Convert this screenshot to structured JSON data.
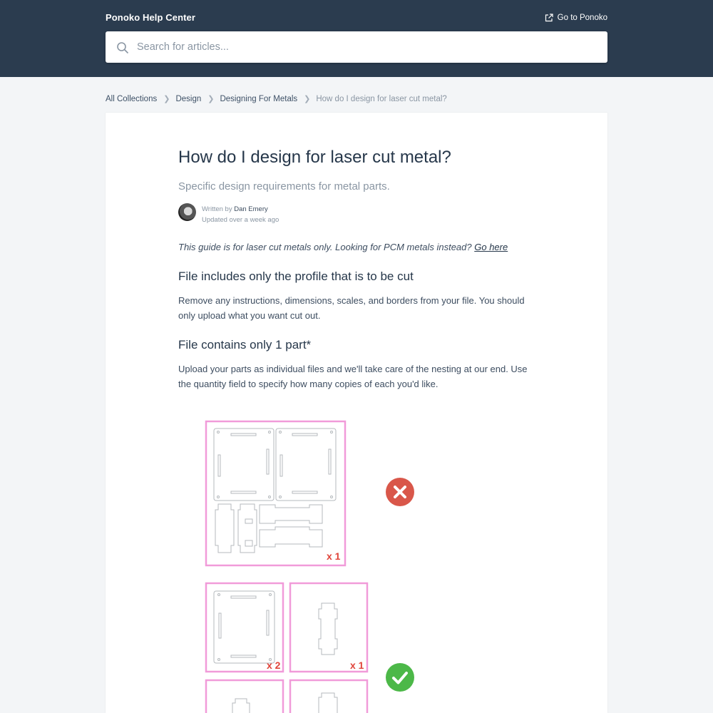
{
  "header": {
    "brand": "Ponoko Help Center",
    "goto_label": "Go to Ponoko",
    "search_placeholder": "Search for articles..."
  },
  "breadcrumbs": {
    "items": [
      "All Collections",
      "Design",
      "Designing For Metals"
    ],
    "current": "How do I design for laser cut metal?"
  },
  "article": {
    "title": "How do I design for laser cut metal?",
    "subtitle": "Specific design requirements for metal parts.",
    "written_by_label": "Written by",
    "author": "Dan Emery",
    "updated": "Updated over a week ago",
    "intro_text": "This guide is for laser cut metals only. Looking for PCM metals instead?",
    "intro_link": "Go here",
    "section1_heading": "File includes only the profile that is to be cut",
    "section1_text": "Remove any instructions, dimensions, scales, and borders from your file. You should only upload what you want cut out.",
    "section2_heading": "File contains only 1 part*",
    "section2_text": "Upload your parts as individual files and we'll take care of the nesting at our end. Use the quantity field to specify how many copies of each you'd like."
  },
  "figure": {
    "wrong_qty": "x 1",
    "right_qty_1": "x 2",
    "right_qty_2": "x 1",
    "colors": {
      "frame": "#f19bd9",
      "qty": "#e0443a",
      "wrong": "#d9574a",
      "right": "#4cb848"
    },
    "icons": [
      "cross-icon",
      "check-icon"
    ]
  }
}
